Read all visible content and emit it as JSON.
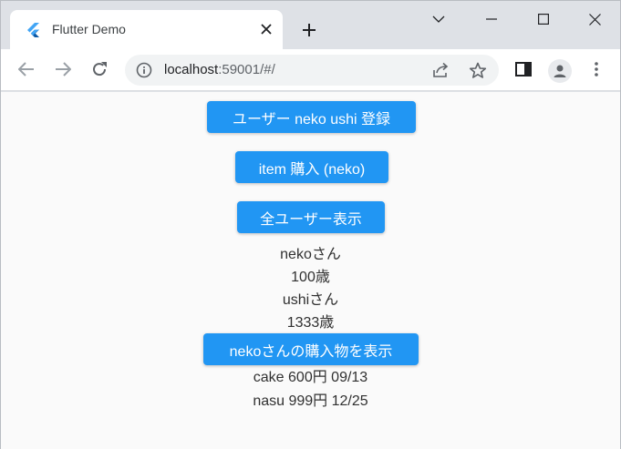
{
  "tab": {
    "title": "Flutter Demo",
    "favicon": "flutter-logo-icon"
  },
  "window_controls": [
    "chevron-down-icon",
    "minimize-icon",
    "maximize-icon",
    "close-icon"
  ],
  "toolbar": {
    "url_host": "localhost",
    "url_path": ":59001/#/"
  },
  "colors": {
    "button": "#2196f3",
    "flutter_blue": "#42a5f5"
  },
  "page": {
    "buttons": {
      "register": "ユーザー neko ushi 登録",
      "purchase": "item 購入 (neko)",
      "show_users": "全ユーザー表示",
      "show_purchases": "nekoさんの購入物を表示"
    },
    "users": [
      {
        "name": "nekoさん",
        "age": "100歳"
      },
      {
        "name": "ushiさん",
        "age": "1333歳"
      }
    ],
    "purchases": [
      "cake 600円 09/13",
      "nasu 999円 12/25"
    ]
  }
}
